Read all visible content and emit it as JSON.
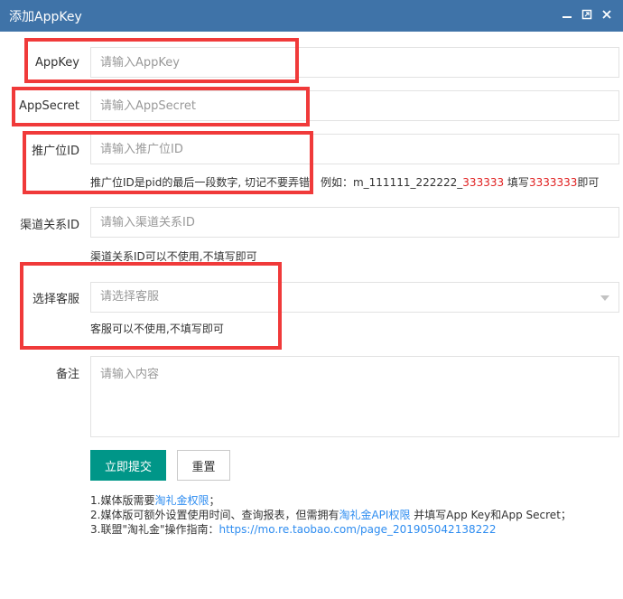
{
  "window": {
    "title": "添加AppKey"
  },
  "form": {
    "appkey": {
      "label": "AppKey",
      "placeholder": "请输入AppKey"
    },
    "appsecret": {
      "label": "AppSecret",
      "placeholder": "请输入AppSecret"
    },
    "pid": {
      "label": "推广位ID",
      "placeholder": "请输入推广位ID",
      "hint_prefix": "推广位ID是pid的最后一段数字, 切记不要弄错，例如：m_111111_222222_",
      "hint_red1": "333333",
      "hint_mid": " 填写",
      "hint_red2": "3333333",
      "hint_suffix": "即可"
    },
    "channel": {
      "label": "渠道关系ID",
      "placeholder": "请输入渠道关系ID",
      "hint": "渠道关系ID可以不使用,不填写即可"
    },
    "service": {
      "label": "选择客服",
      "placeholder": "请选择客服",
      "hint": "客服可以不使用,不填写即可"
    },
    "remark": {
      "label": "备注",
      "placeholder": "请输入内容"
    }
  },
  "buttons": {
    "submit": "立即提交",
    "reset": "重置"
  },
  "notes": {
    "line1_prefix": "1.媒体版需要",
    "line1_link": "淘礼金权限",
    "line1_suffix": "；",
    "line2_prefix": "2.媒体版可额外设置使用时间、查询报表，但需拥有",
    "line2_link": "淘礼金API权限",
    "line2_suffix": " 并填写App Key和App Secret；",
    "line3_prefix": "3.联盟\"淘礼金\"操作指南：",
    "line3_link": "https://mo.re.taobao.com/page_201905042138222"
  },
  "colors": {
    "titlebar": "#3f73a8",
    "primary": "#009688",
    "link": "#2d8cf0",
    "highlight": "#e02020",
    "annotation": "#f03a3a"
  }
}
